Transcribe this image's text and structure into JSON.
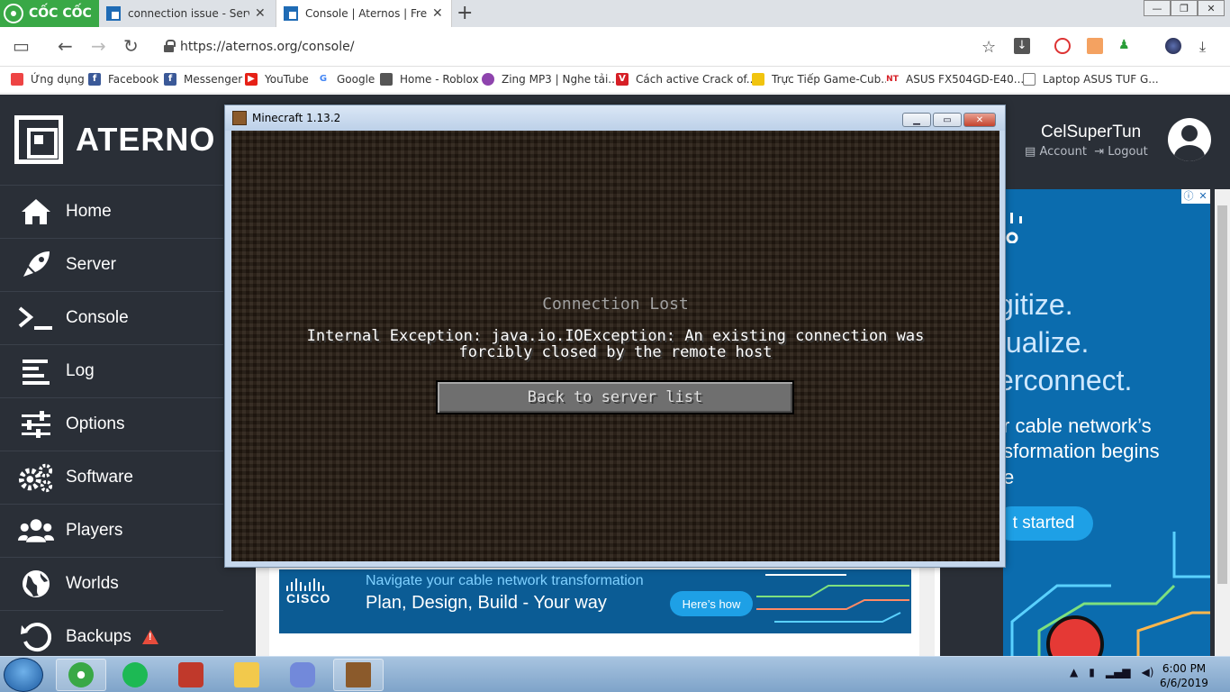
{
  "browser": {
    "brand": "CỐC CỐC",
    "tabs": [
      {
        "title": "connection issue - Server",
        "active": false
      },
      {
        "title": "Console | Aternos | Free M",
        "active": true
      }
    ],
    "new_tab": "+",
    "window_controls": {
      "minimize": "—",
      "maximize": "❐",
      "close": "✕"
    },
    "url": "https://aternos.org/console/",
    "bookmarks": [
      {
        "label": "Ứng dụng",
        "icon": "apps-grid-icon",
        "color": "#e44"
      },
      {
        "label": "Facebook",
        "icon": "facebook-icon",
        "color": "#3b5998"
      },
      {
        "label": "Messenger",
        "icon": "facebook-icon",
        "color": "#3b5998"
      },
      {
        "label": "YouTube",
        "icon": "youtube-icon",
        "color": "#e62117"
      },
      {
        "label": "Google",
        "icon": "google-icon",
        "color": "#4285f4"
      },
      {
        "label": "Home - Roblox",
        "icon": "roblox-icon",
        "color": "#555"
      },
      {
        "label": "Zing MP3 | Nghe tải...",
        "icon": "zing-icon",
        "color": "#8e44ad"
      },
      {
        "label": "Cách active Crack of...",
        "icon": "v-icon",
        "color": "#d61f26"
      },
      {
        "label": "Trực Tiếp Game-Cub...",
        "icon": "game-icon",
        "color": "#f1c40f"
      },
      {
        "label": "ASUS FX504GD-E40...",
        "icon": "nt-icon",
        "color": "#d61f26"
      },
      {
        "label": "Laptop ASUS TUF G...",
        "icon": "page-icon",
        "color": "#999"
      }
    ]
  },
  "aternos": {
    "brand": "ATERNO",
    "user": {
      "name": "CelSuperTun",
      "account": "Account",
      "logout": "Logout"
    },
    "nav": [
      {
        "label": "Home",
        "icon": "home-icon"
      },
      {
        "label": "Server",
        "icon": "rocket-icon"
      },
      {
        "label": "Console",
        "icon": "terminal-icon"
      },
      {
        "label": "Log",
        "icon": "log-lines-icon"
      },
      {
        "label": "Options",
        "icon": "sliders-icon"
      },
      {
        "label": "Software",
        "icon": "gears-icon"
      },
      {
        "label": "Players",
        "icon": "users-icon"
      },
      {
        "label": "Worlds",
        "icon": "globe-icon"
      },
      {
        "label": "Backups",
        "icon": "backup-icon",
        "warning": true
      }
    ],
    "ad_right": {
      "lines": [
        "gitize.",
        "tualize.",
        "erconnect."
      ],
      "para": [
        "r cable network’s",
        "sformation begins",
        "e"
      ],
      "cta": "t started"
    },
    "ad_bottom": {
      "brand": "CISCO",
      "headline": "Navigate your cable network transformation",
      "subline": "Plan, Design, Build - Your way",
      "cta": "Here’s how"
    }
  },
  "minecraft": {
    "title": "Minecraft 1.13.2",
    "heading": "Connection Lost",
    "message": "Internal Exception: java.io.IOException: An existing connection was forcibly closed by the remote host",
    "button": "Back to server list"
  },
  "taskbar": {
    "time": "6:00 PM",
    "date": "6/6/2019"
  }
}
